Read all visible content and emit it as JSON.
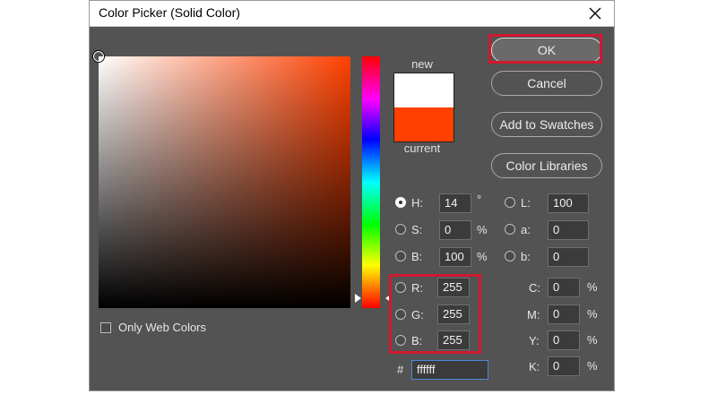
{
  "window": {
    "title": "Color Picker (Solid Color)",
    "close_glyph": "✕"
  },
  "preview": {
    "new_label": "new",
    "current_label": "current",
    "new_color": "#ffffff",
    "current_color": "#ff4000"
  },
  "buttons": {
    "ok": "OK",
    "cancel": "Cancel",
    "add_to_swatches": "Add to Swatches",
    "color_libraries": "Color Libraries"
  },
  "hsb": {
    "h": {
      "label": "H:",
      "value": "14",
      "unit": "°",
      "selected": true
    },
    "s": {
      "label": "S:",
      "value": "0",
      "unit": "%"
    },
    "b": {
      "label": "B:",
      "value": "100",
      "unit": "%"
    }
  },
  "lab": {
    "l": {
      "label": "L:",
      "value": "100"
    },
    "a": {
      "label": "a:",
      "value": "0"
    },
    "b": {
      "label": "b:",
      "value": "0"
    }
  },
  "rgb": {
    "r": {
      "label": "R:",
      "value": "255"
    },
    "g": {
      "label": "G:",
      "value": "255"
    },
    "b": {
      "label": "B:",
      "value": "255"
    }
  },
  "cmyk": {
    "c": {
      "label": "C:",
      "value": "0",
      "unit": "%"
    },
    "m": {
      "label": "M:",
      "value": "0",
      "unit": "%"
    },
    "y": {
      "label": "Y:",
      "value": "0",
      "unit": "%"
    },
    "k": {
      "label": "K:",
      "value": "0",
      "unit": "%"
    }
  },
  "hex": {
    "label": "#",
    "value": "ffffff"
  },
  "web_colors": {
    "label": "Only Web Colors",
    "checked": false
  },
  "colors": {
    "dialog_bg": "#535353",
    "highlight": "#d0182f"
  },
  "icons": {
    "close": "close-icon"
  }
}
